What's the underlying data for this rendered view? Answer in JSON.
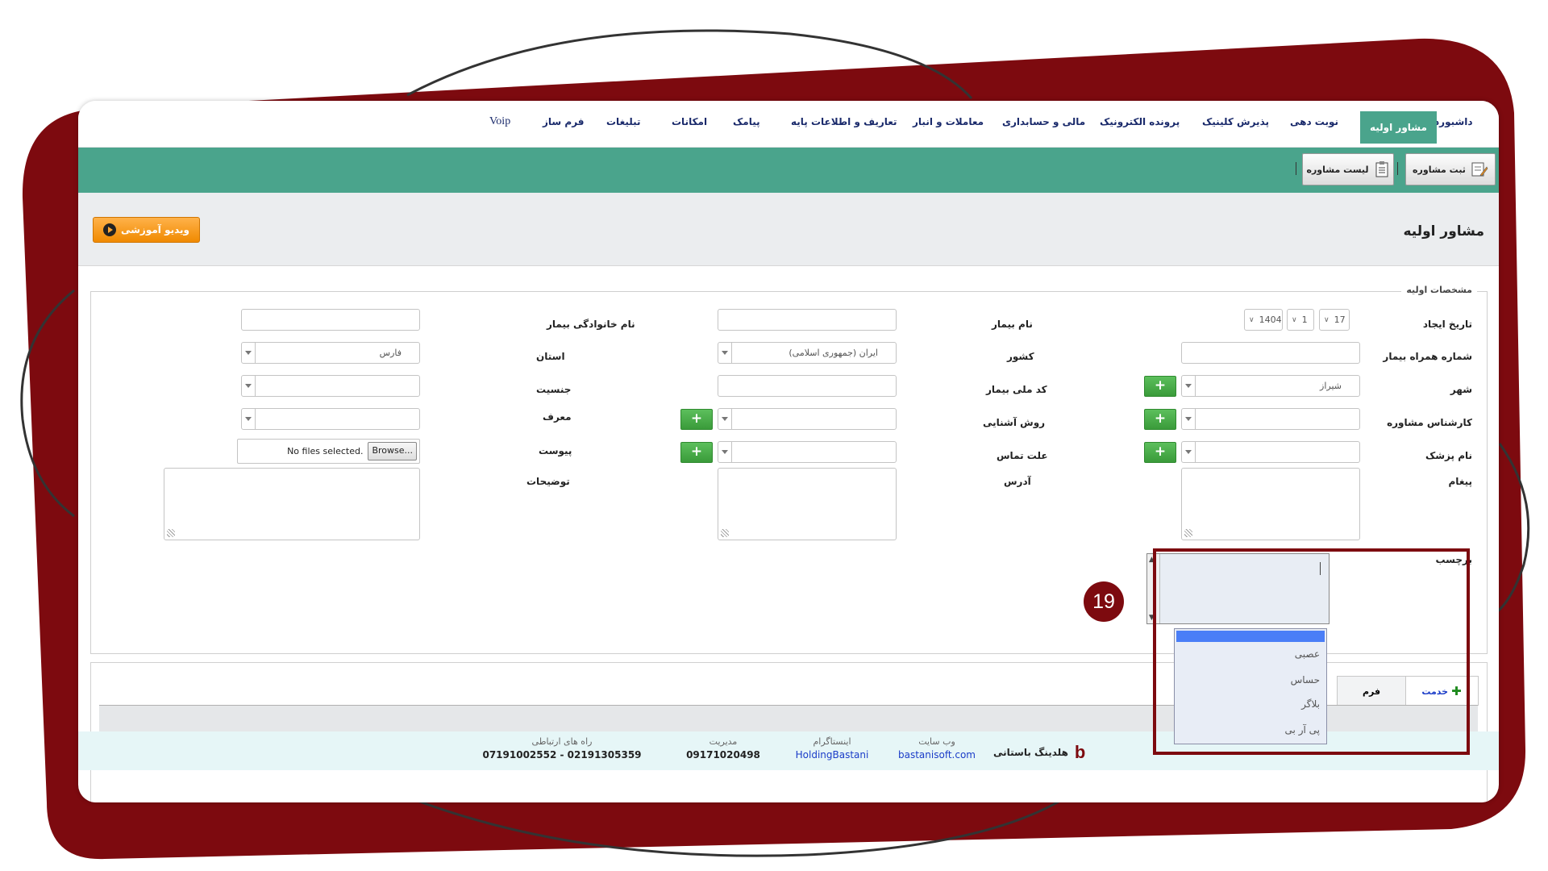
{
  "colors": {
    "frame": "#7d0a0f",
    "accent_green": "#4aa48c",
    "orange": "#f39a1c",
    "link_blue": "#1a3cc8"
  },
  "menu": {
    "items": [
      {
        "key": "dashboard",
        "label": "داشبورد"
      },
      {
        "key": "initial_consultant",
        "label": "مشاور اولیه",
        "active": true
      },
      {
        "key": "appointment",
        "label": "نوبت دهی"
      },
      {
        "key": "clinic_reception",
        "label": "پذیرش کلینیک"
      },
      {
        "key": "e_record",
        "label": "پرونده الکترونیک"
      },
      {
        "key": "finance",
        "label": "مالی و حسابداری"
      },
      {
        "key": "trade_warehouse",
        "label": "معاملات و انبار"
      },
      {
        "key": "base_info",
        "label": "تعاریف و اطلاعات پایه"
      },
      {
        "key": "sms",
        "label": "پیامک"
      },
      {
        "key": "facilities",
        "label": "امکانات"
      },
      {
        "key": "advertising",
        "label": "تبلیغات"
      },
      {
        "key": "form_builder",
        "label": "فرم ساز"
      },
      {
        "key": "voip",
        "label": "Voip"
      }
    ]
  },
  "toolbar": {
    "register_label": "ثبت مشاوره",
    "list_label": "لیست مشاوره",
    "register_icon": "form-edit-icon",
    "list_icon": "clipboard-icon"
  },
  "page": {
    "title": "مشاور اولیه",
    "video_button": "ویدیو آموزشی",
    "video_icon": "play-icon"
  },
  "form": {
    "legend": "مشخصات اولیه",
    "labels": {
      "created_date": "تاریخ ایجاد",
      "patient_name": "نام بیمار",
      "family_name": "نام خانوادگی بیمار",
      "mobile": "شماره همراه بیمار",
      "country": "کشور",
      "province": "استان",
      "city": "شهر",
      "national_id": "کد ملی بیمار",
      "gender": "جنسیت",
      "consultant": "کارشناس مشاوره",
      "acquaintance": "روش آشنایی",
      "referrer": "معرف",
      "doctor": "نام پزشک",
      "contact_reason": "علت تماس",
      "attachment": "پیوست",
      "message": "پیغام",
      "address": "آدرس",
      "description": "توضیحات",
      "tag": "برچسب"
    },
    "values": {
      "day": "17",
      "month": "1",
      "year": "1404",
      "country": "ایران (جمهوری اسلامی)",
      "province": "فارس",
      "city": "شیراز",
      "file_status": "No files selected.",
      "browse": "Browse..."
    },
    "tag_options": [
      "عصبی",
      "حساس",
      "بلاگر",
      "پی آر بی"
    ]
  },
  "tabs": {
    "service": "خدمت",
    "form": "فرم"
  },
  "footer": {
    "brand": "هلدینگ باستانی",
    "website_caption": "وب سایت",
    "website": "bastanisoft.com",
    "instagram_caption": "اینستاگرام",
    "instagram": "HoldingBastani",
    "management_caption": "مدیریت",
    "management": "09171020498",
    "contact_caption": "راه های ارتباطی",
    "contact": "07191002552 - 02191305359"
  },
  "annotation": {
    "step": "19"
  }
}
